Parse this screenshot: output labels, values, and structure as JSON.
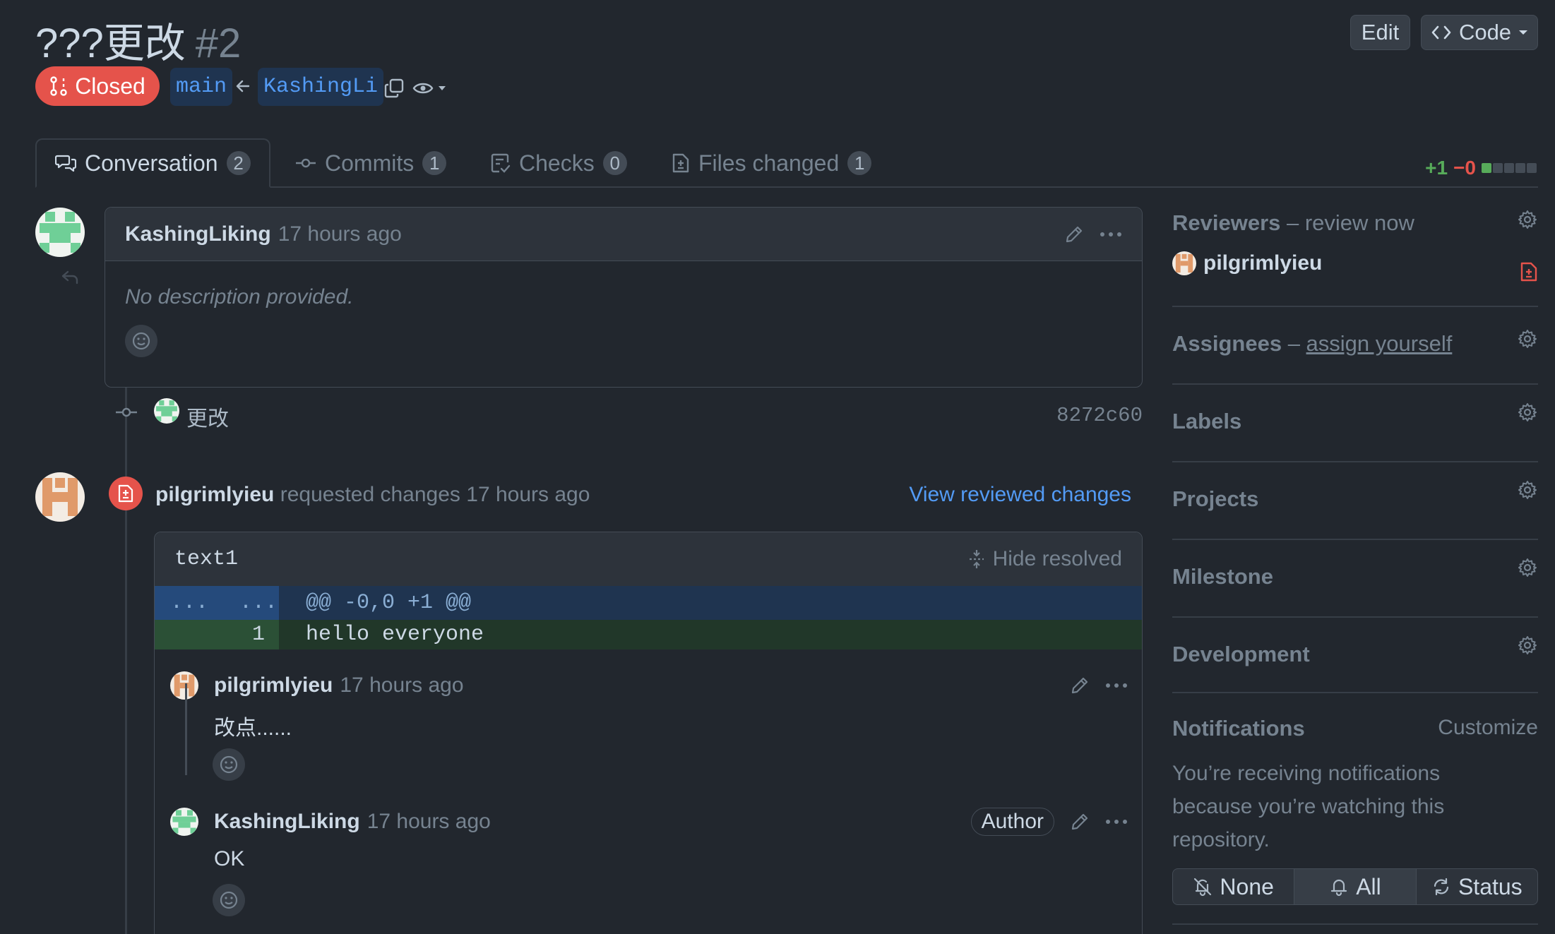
{
  "header": {
    "title": "???更改",
    "number": "#2",
    "edit_label": "Edit",
    "code_label": "Code",
    "state_label": "Closed",
    "base_branch": "main",
    "head_branch": "KashingLi"
  },
  "tabs": [
    {
      "label": "Conversation",
      "count": "2"
    },
    {
      "label": "Commits",
      "count": "1"
    },
    {
      "label": "Checks",
      "count": "0"
    },
    {
      "label": "Files changed",
      "count": "1"
    }
  ],
  "diffstat": {
    "additions": "+1",
    "deletions": "−0"
  },
  "opening_comment": {
    "author": "KashingLiking",
    "time": "17 hours ago",
    "body": "No description provided."
  },
  "commit": {
    "message": "更改",
    "sha": "8272c60"
  },
  "review": {
    "author": "pilgrimlyieu",
    "action": "requested changes",
    "time": "17 hours ago",
    "view_link": "View reviewed changes",
    "file": "text1",
    "hide_resolved": "Hide resolved",
    "hunk_gutter_old": "...",
    "hunk_gutter_new": "...",
    "hunk_header": "@@ -0,0 +1 @@",
    "line_number": "1",
    "line_code": "hello everyone"
  },
  "thread": [
    {
      "author": "pilgrimlyieu",
      "time": "17 hours ago",
      "body": "改点......",
      "badge": ""
    },
    {
      "author": "KashingLiking",
      "time": "17 hours ago",
      "body": "OK",
      "badge": "Author"
    }
  ],
  "sidebar": {
    "reviewers_title": "Reviewers",
    "reviewers_sep": " – ",
    "reviewers_action": "review now",
    "reviewer_name": "pilgrimlyieu",
    "assignees_title": "Assignees",
    "assignees_sep": " – ",
    "assignees_action": "assign yourself",
    "labels_title": "Labels",
    "projects_title": "Projects",
    "milestone_title": "Milestone",
    "development_title": "Development",
    "notifications_title": "Notifications",
    "customize_label": "Customize",
    "notifications_text": "You’re receiving notifications because you’re watching this repository.",
    "notif_none": "None",
    "notif_all": "All",
    "notif_status": "Status"
  },
  "colors": {
    "background": "#22272e",
    "closed_badge": "#e5534b",
    "link": "#539bf5",
    "addition": "#57ab5a",
    "deletion": "#e5534b"
  },
  "icons": [
    "closed-pr-icon",
    "copy-icon",
    "eye-icon",
    "code-icon",
    "comment-discussion-icon",
    "commit-icon",
    "checklist-icon",
    "file-diff-icon",
    "kebab-icon",
    "pencil-icon",
    "smiley-icon",
    "reply-icon",
    "file-diff-request-changes-icon",
    "unfold-icon",
    "gear-icon",
    "bell-slash-icon",
    "bell-icon",
    "sync-icon"
  ]
}
